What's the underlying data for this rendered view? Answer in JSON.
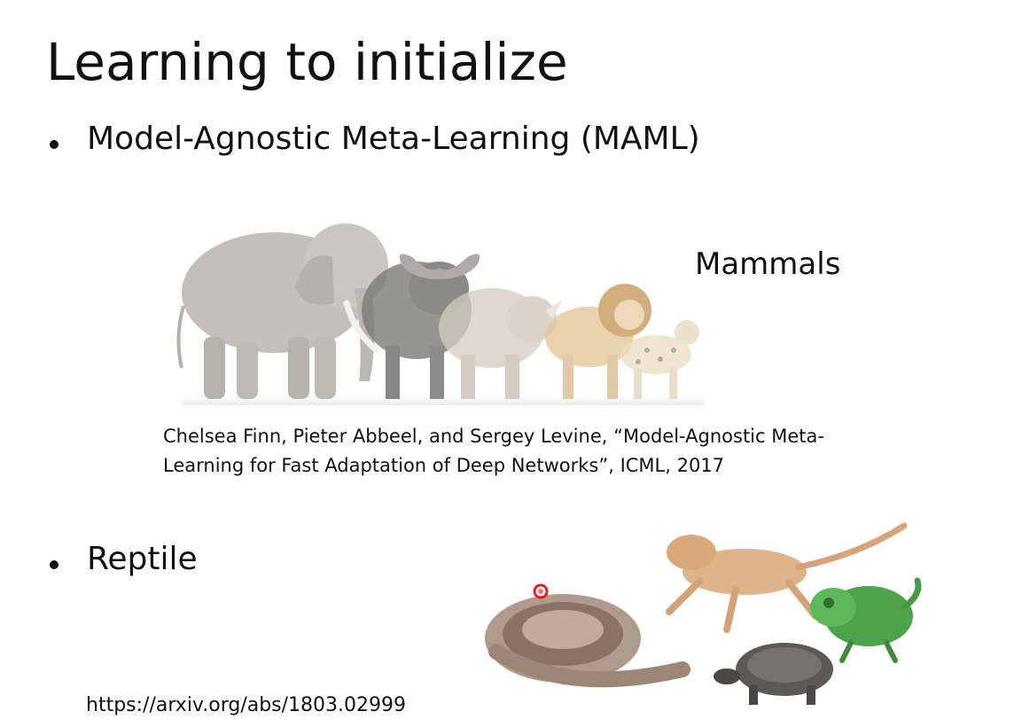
{
  "slide": {
    "title": "Learning to initialize",
    "bullets": [
      {
        "text": "Model-Agnostic Meta-Learning (MAML)"
      },
      {
        "text": "Reptile"
      }
    ],
    "mammals_label": "Mammals",
    "citation_line1": "Chelsea Finn, Pieter Abbeel, and Sergey Levine, “Model-Agnostic Meta-",
    "citation_line2": "Learning for Fast Adaptation of Deep Networks”, ICML, 2017",
    "url": "https://arxiv.org/abs/1803.02999"
  },
  "images": {
    "mammals": [
      "elephant",
      "buffalo",
      "rhinoceros",
      "lion",
      "leopard"
    ],
    "reptiles": [
      "snake",
      "bearded-dragon",
      "chameleon",
      "tortoise"
    ]
  },
  "colors": {
    "text": "#111111",
    "laser_pointer": "#e02020"
  }
}
